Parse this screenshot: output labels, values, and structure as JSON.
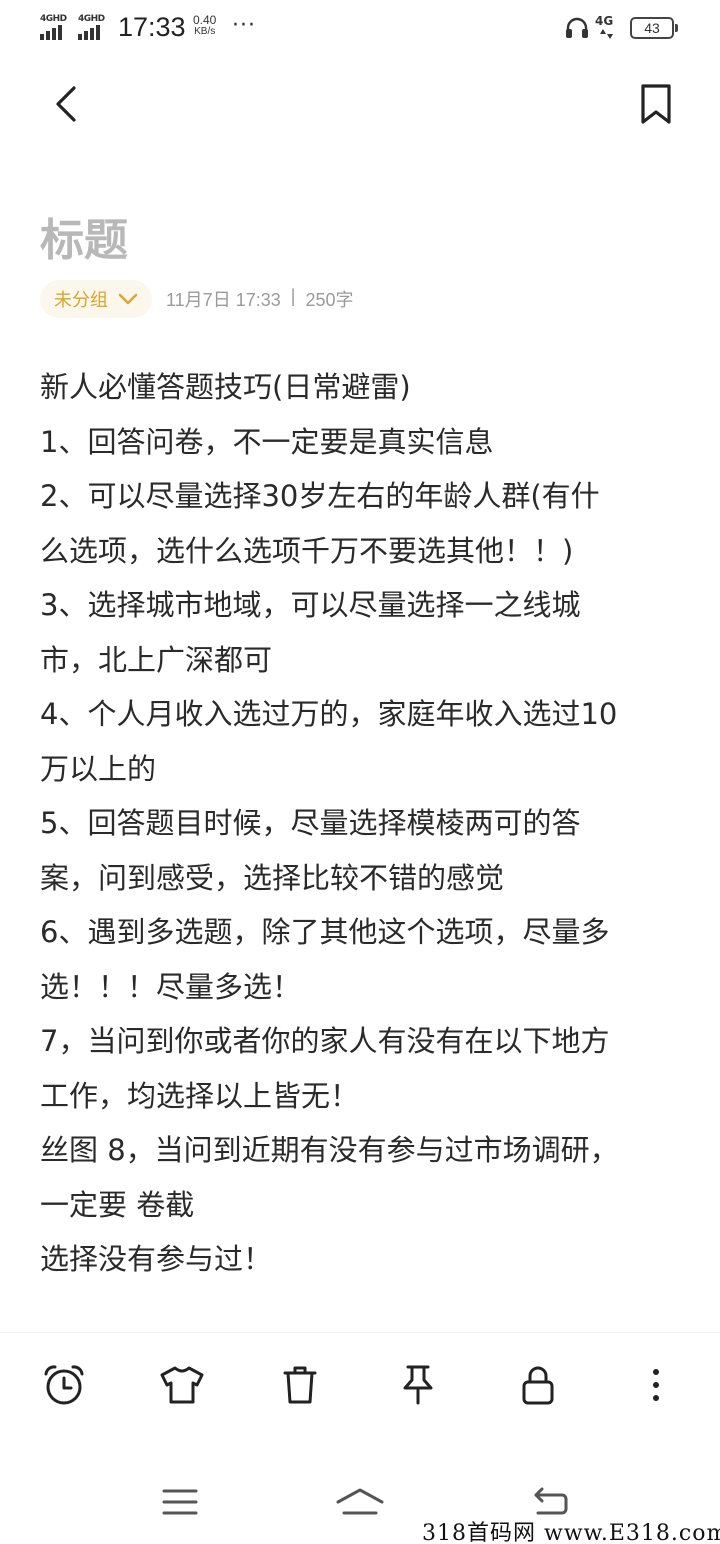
{
  "status_bar": {
    "signal1_label": "4GHD",
    "signal2_label": "4GHD",
    "time": "17:33",
    "speed_value": "0.40",
    "speed_unit": "KB/s",
    "more": "···",
    "network_label": "4G",
    "battery": "43"
  },
  "note": {
    "title": "标题",
    "group": "未分组",
    "date": "11月7日 17:33",
    "separator": "|",
    "word_count": "250字",
    "lines": [
      "新人必懂答题技巧(日常避雷)",
      "1、回答问卷，不一定要是真实信息",
      "2、可以尽量选择30岁左右的年龄人群(有什",
      "么选项，选什么选项千万不要选其他！！)",
      "3、选择城市地域，可以尽量选择一之线城",
      "市，北上广深都可",
      "4、个人月收入选过万的，家庭年收入选过10",
      "万以上的",
      "5、回答题目时候，尽量选择模棱两可的答",
      "案，问到感受，选择比较不错的感觉",
      "6、遇到多选题，除了其他这个选项，尽量多",
      "选！！！尽量多选！",
      "7，当问到你或者你的家人有没有在以下地方",
      "工作，均选择以上皆无！",
      "丝图 8，当问到近期有没有参与过市场调研，",
      "一定要 卷截",
      "选择没有参与过！"
    ]
  },
  "toolbar_icons": [
    "alarm-clock-icon",
    "t-shirt-icon",
    "trash-icon",
    "pin-icon",
    "lock-icon",
    "more-vertical-icon"
  ],
  "nav_icons": [
    "menu-icon",
    "home-icon",
    "back-icon"
  ],
  "watermark": "318首码网 www.E318.com",
  "colors": {
    "accent": "#d9a62b",
    "title_gray": "#b8b8b8",
    "meta_gray": "#9a9a9a",
    "text": "#2a2a2a"
  }
}
